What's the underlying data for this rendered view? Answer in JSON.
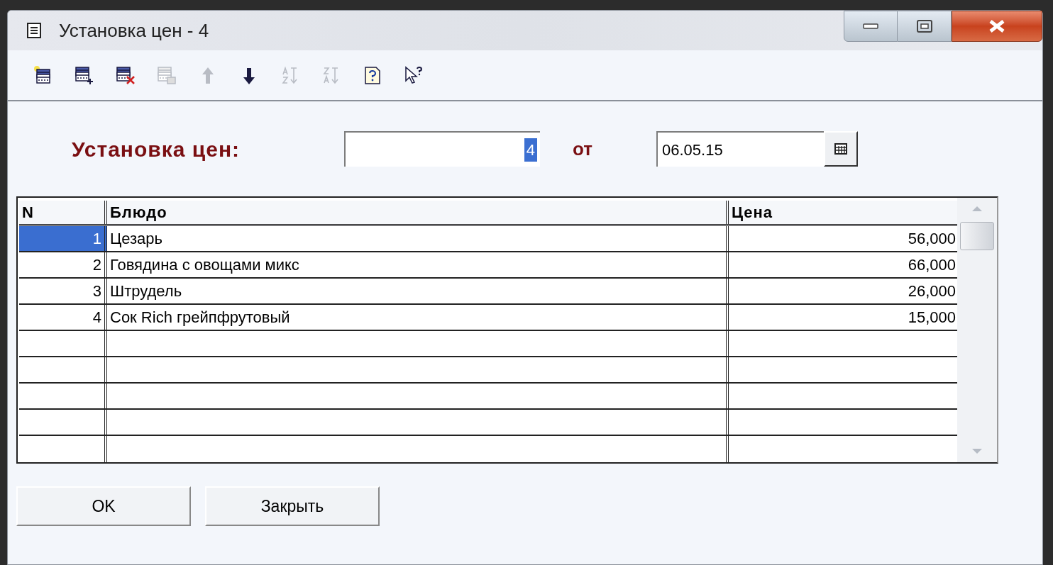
{
  "window": {
    "title": "Установка цен - 4"
  },
  "toolbar": [
    {
      "kind": "new",
      "disabled": false
    },
    {
      "kind": "add",
      "disabled": false
    },
    {
      "kind": "delete",
      "disabled": false
    },
    {
      "kind": "copy",
      "disabled": true
    },
    {
      "kind": "up",
      "disabled": true
    },
    {
      "kind": "down",
      "disabled": false
    },
    {
      "kind": "sort-asc",
      "disabled": true
    },
    {
      "kind": "sort-desc",
      "disabled": true
    },
    {
      "kind": "help",
      "disabled": false
    },
    {
      "kind": "whats-this",
      "disabled": false
    }
  ],
  "form": {
    "label": "Установка цен:",
    "number": {
      "value": "4",
      "value_selected": true
    },
    "from_label": "от",
    "date": {
      "value": "06.05.15"
    }
  },
  "table": {
    "columns": [
      "N",
      "Блюдо",
      "Цена"
    ],
    "rows": [
      {
        "n": "1",
        "dish": "Цезарь",
        "price": "56,000",
        "selected": true
      },
      {
        "n": "2",
        "dish": "Говядина с овощами микс",
        "price": "66,000",
        "selected": false
      },
      {
        "n": "3",
        "dish": "Штрудель",
        "price": "26,000",
        "selected": false
      },
      {
        "n": "4",
        "dish": "Сок Rich грейпфрутовый",
        "price": "15,000",
        "selected": false
      }
    ]
  },
  "buttons": [
    "OK",
    "Закрыть"
  ]
}
